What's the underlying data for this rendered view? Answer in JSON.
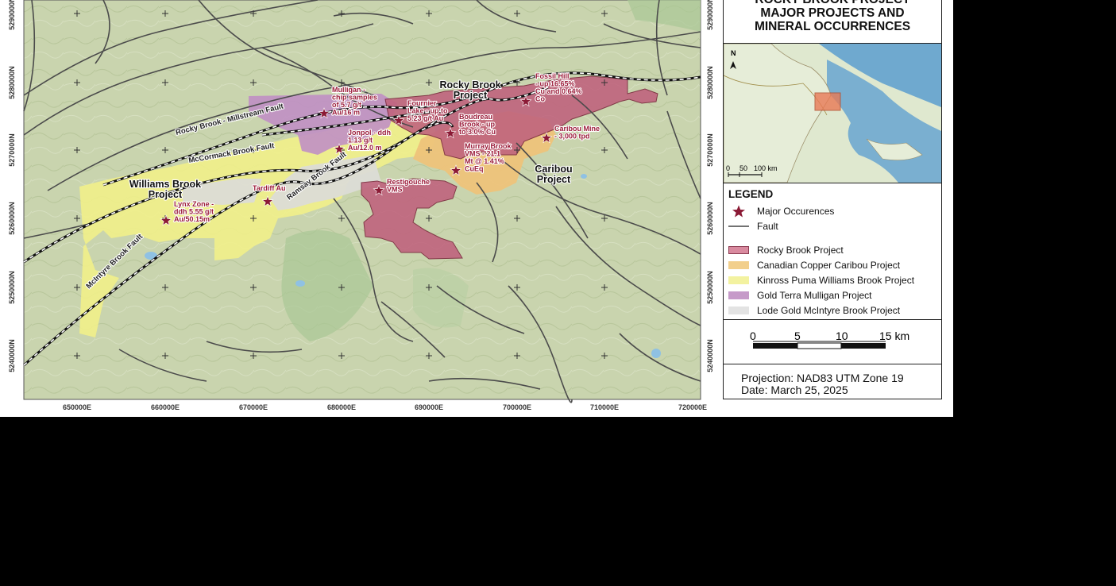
{
  "title": [
    "ROCKY BROOK PROJECT",
    "MAJOR PROJECTS AND",
    "MINERAL OCCURRENCES"
  ],
  "easting_ticks": [
    "650000E",
    "660000E",
    "670000E",
    "680000E",
    "690000E",
    "700000E",
    "710000E",
    "720000E"
  ],
  "northing_ticks": [
    "5290000N",
    "5280000N",
    "5270000N",
    "5260000N",
    "5250000N",
    "5240000N"
  ],
  "faults": {
    "millstream": "Rocky Brook - Millstream Fault",
    "mccormack": "McCormack Brook Fault",
    "ramsay": "Ramsay Brook Fault",
    "mcintyre": "McIntyre Brook Fault"
  },
  "projects": {
    "rocky_brook": [
      "Rocky Brook",
      "Project"
    ],
    "williams_brook": [
      "Williams Brook",
      "Project"
    ],
    "caribou": [
      "Caribou",
      "Project"
    ]
  },
  "occurrences": [
    {
      "id": "mulligan",
      "lines": [
        "Mulligan -",
        "chip samples",
        "of 5.7 g/t",
        "Au/16 m"
      ]
    },
    {
      "id": "fournier",
      "lines": [
        "Fournier",
        "Lake - up to",
        "5.23 g/t Au"
      ]
    },
    {
      "id": "boudreau",
      "lines": [
        "Boudreau",
        "Brook - up",
        "to 3.0% Cu"
      ]
    },
    {
      "id": "fossil_hill",
      "lines": [
        "Fossil Hill",
        "- up 16.65%",
        "Cu and 0.64%",
        "Co"
      ]
    },
    {
      "id": "caribou_mine",
      "lines": [
        "Caribou Mine",
        "- 3,000 tpd"
      ]
    },
    {
      "id": "jonpol",
      "lines": [
        "Jonpol - ddh",
        "1.13 g/t",
        "Au/12.0 m"
      ]
    },
    {
      "id": "murray_brook",
      "lines": [
        "Murray Brook",
        "VMS - 21.1",
        "Mt @ 1.41%",
        "CuEq"
      ]
    },
    {
      "id": "restigouche",
      "lines": [
        "Restigouche",
        "VMS"
      ]
    },
    {
      "id": "tardiff",
      "lines": [
        "Tardiff Au"
      ]
    },
    {
      "id": "lynx",
      "lines": [
        "Lynx Zone -",
        "ddh 5.55 g/t",
        "Au/50.15m"
      ]
    }
  ],
  "inset": {
    "scale_labels": [
      "0",
      "50",
      "100 km"
    ],
    "north": "N"
  },
  "legend": {
    "title": "LEGEND",
    "items": [
      {
        "label": "Major Occurences",
        "symbol": "star-icon",
        "color": "#8b1a35"
      },
      {
        "label": "Fault",
        "symbol": "line",
        "color": "#444444"
      },
      {
        "label": "Rocky Brook Project",
        "symbol": "swatch",
        "color": "#d98a9f"
      },
      {
        "label": "Canadian Copper Caribou Project",
        "symbol": "swatch",
        "color": "#f2cf8c"
      },
      {
        "label": "Kinross Puma Williams Brook Project",
        "symbol": "swatch",
        "color": "#f3f2a0"
      },
      {
        "label": "Gold Terra Mulligan Project",
        "symbol": "swatch",
        "color": "#c69ac9"
      },
      {
        "label": "Lode Gold McIntyre Brook Project",
        "symbol": "swatch",
        "color": "#e3e3e3"
      }
    ]
  },
  "scale_bar": {
    "labels": [
      "0",
      "5",
      "10",
      "15 km"
    ]
  },
  "projection": [
    "Projection: NAD83 UTM Zone 19",
    "Date: March 25, 2025"
  ],
  "colors": {
    "terrain": "#c7d3ad",
    "rocky_brook": "#c0647e",
    "caribou": "#eec37a",
    "williams_brook": "#f1ef8a",
    "mulligan": "#c08fc4",
    "mcintyre": "#dcdcd6",
    "star": "#8b1a35"
  }
}
